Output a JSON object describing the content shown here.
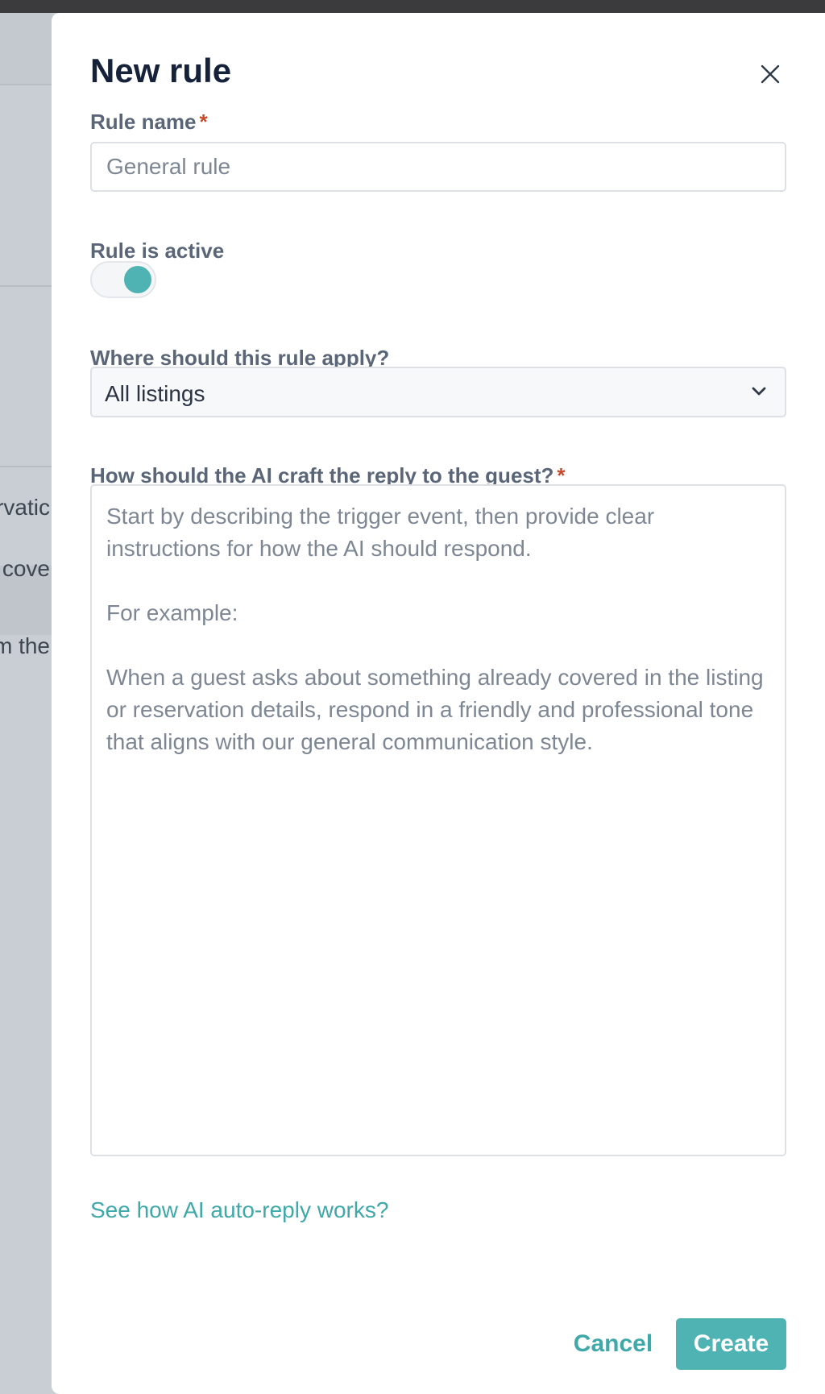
{
  "background": {
    "fragments": [
      "rvatic",
      "y cove",
      "m the"
    ]
  },
  "modal": {
    "title": "New rule",
    "close_icon": "close-icon",
    "rule_name": {
      "label": "Rule name",
      "required_mark": "*",
      "value": "",
      "placeholder": "General rule"
    },
    "rule_active": {
      "label": "Rule is active",
      "checked": true
    },
    "apply_scope": {
      "label": "Where should this rule apply?",
      "selected": "All listings",
      "icon": "chevron-down-icon"
    },
    "reply_instructions": {
      "label": "How should the AI craft the reply to the guest?",
      "required_mark": "*",
      "value": "",
      "placeholder": "Start by describing the trigger event, then provide clear instructions for how the AI should respond.\n\nFor example:\n\nWhen a guest asks about something already covered in the listing or reservation details, respond in a friendly and professional tone that aligns with our general communication style."
    },
    "help_link": "See how AI auto-reply works?",
    "cancel_label": "Cancel",
    "create_label": "Create"
  },
  "colors": {
    "accent": "#4fb3b3",
    "link": "#3fa8a8",
    "required": "#c94a2a",
    "title": "#16223a",
    "label": "#5a6678"
  }
}
